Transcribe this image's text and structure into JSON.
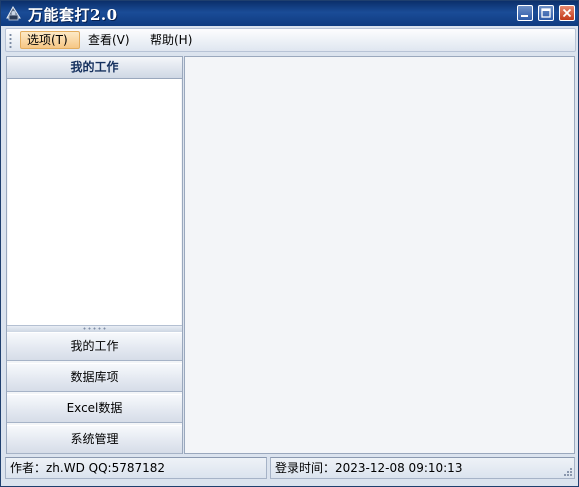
{
  "window": {
    "title": "万能套打2.0"
  },
  "menu": {
    "items": [
      "选项(T)",
      "查看(V)",
      "帮助(H)"
    ]
  },
  "left_panel": {
    "header": "我的工作",
    "nav_buttons": [
      "我的工作",
      "数据库项",
      "Excel数据",
      "系统管理"
    ]
  },
  "status": {
    "author": "作者：zh.WD   QQ:5787182",
    "login_time": "登录时间：2023-12-08 09:10:13"
  },
  "icons": {
    "app": "app-icon",
    "minimize": "minimize-icon",
    "maximize": "maximize-icon",
    "close": "close-icon"
  },
  "colors": {
    "titlebar": "#1a4c97",
    "menu_active": "#f6c785",
    "panel_header_text": "#15305e",
    "workspace": "#f3f5f8"
  }
}
